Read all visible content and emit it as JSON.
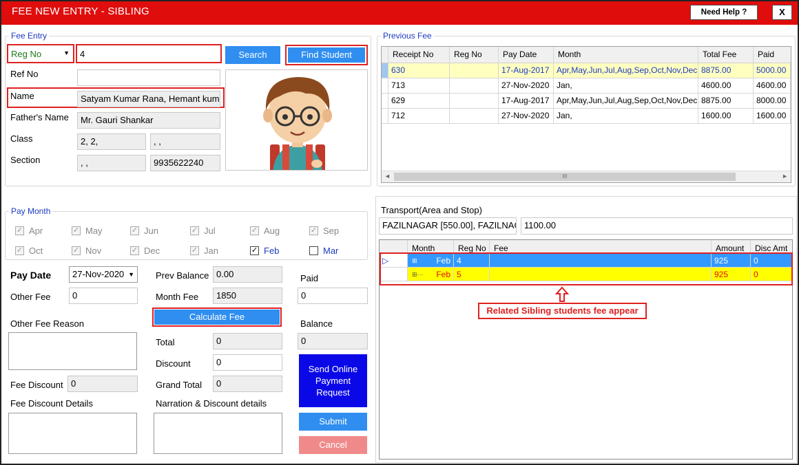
{
  "window": {
    "title": "FEE NEW ENTRY - SIBLING",
    "help_label": "Need Help ?",
    "close_label": "X"
  },
  "fee_entry": {
    "legend": "Fee Entry",
    "search_by": "Reg No",
    "search_value": "4",
    "search_label": "Search",
    "find_student_label": "Find Student",
    "ref_no_label": "Ref No",
    "ref_no_value": "",
    "name_label": "Name",
    "name_value": "Satyam Kumar Rana,  Hemant kum",
    "father_label": "Father's Name",
    "father_value": "Mr. Gauri Shankar",
    "class_label": "Class",
    "class_value_1": "2, 2,",
    "class_value_2": ", ,",
    "section_label": "Section",
    "section_value": ", ,",
    "phone_value": "9935622240"
  },
  "previous_fee": {
    "legend": "Previous Fee",
    "columns": [
      "Receipt No",
      "Reg No",
      "Pay Date",
      "Month",
      "Total Fee",
      "Paid"
    ],
    "rows": [
      {
        "receipt": "630",
        "reg": "",
        "date": "17-Aug-2017",
        "month": "Apr,May,Jun,Jul,Aug,Sep,Oct,Nov,Dec,",
        "total": "8875.00",
        "paid": "5000.00"
      },
      {
        "receipt": "713",
        "reg": "",
        "date": "27-Nov-2020",
        "month": "Jan,",
        "total": "4600.00",
        "paid": "4600.00"
      },
      {
        "receipt": "629",
        "reg": "",
        "date": "17-Aug-2017",
        "month": "Apr,May,Jun,Jul,Aug,Sep,Oct,Nov,Dec,",
        "total": "8875.00",
        "paid": "8000.00"
      },
      {
        "receipt": "712",
        "reg": "",
        "date": "27-Nov-2020",
        "month": "Jan,",
        "total": "1600.00",
        "paid": "1600.00"
      }
    ],
    "scroll_glyph": "III"
  },
  "pay_month": {
    "legend": "Pay Month",
    "months": [
      {
        "label": "Apr",
        "checked": true,
        "enabled": false
      },
      {
        "label": "May",
        "checked": true,
        "enabled": false
      },
      {
        "label": "Jun",
        "checked": true,
        "enabled": false
      },
      {
        "label": "Jul",
        "checked": true,
        "enabled": false
      },
      {
        "label": "Aug",
        "checked": true,
        "enabled": false
      },
      {
        "label": "Sep",
        "checked": true,
        "enabled": false
      },
      {
        "label": "Oct",
        "checked": true,
        "enabled": false
      },
      {
        "label": "Nov",
        "checked": true,
        "enabled": false
      },
      {
        "label": "Dec",
        "checked": true,
        "enabled": false
      },
      {
        "label": "Jan",
        "checked": true,
        "enabled": false
      },
      {
        "label": "Feb",
        "checked": true,
        "enabled": true
      },
      {
        "label": "Mar",
        "checked": false,
        "enabled": true
      }
    ]
  },
  "payment": {
    "pay_date_label": "Pay Date",
    "pay_date_value": "27-Nov-2020",
    "other_fee_label": "Other Fee",
    "other_fee_value": "0",
    "other_fee_reason_label": "Other Fee Reason",
    "fee_discount_label": "Fee Discount",
    "fee_discount_value": "0",
    "fee_discount_details_label": "Fee Discount Details",
    "prev_balance_label": "Prev Balance",
    "prev_balance_value": "0.00",
    "month_fee_label": "Month Fee",
    "month_fee_value": "1850",
    "calculate_label": "Calculate Fee",
    "total_label": "Total",
    "total_value": "0",
    "discount_label": "Discount",
    "discount_value": "0",
    "grand_total_label": "Grand Total",
    "grand_total_value": "0",
    "narration_label": "Narration & Discount  details",
    "paid_label": "Paid",
    "paid_value": "0",
    "balance_label": "Balance",
    "balance_value": "0",
    "send_online_label": "Send Online Payment Request",
    "submit_label": "Submit",
    "cancel_label": "Cancel"
  },
  "transport": {
    "label": "Transport(Area and Stop)",
    "area_value": "FAZILNAGAR [550.00], FAZILNAGA",
    "amount_value": "1100.00"
  },
  "sibling_grid": {
    "columns": [
      "Month",
      "Reg No",
      "Fee",
      "Amount",
      "Disc Amt"
    ],
    "rows": [
      {
        "month": "Feb",
        "reg": "4",
        "fee": "",
        "amount": "925",
        "disc": "0"
      },
      {
        "month": "Feb",
        "reg": "5",
        "fee": "",
        "amount": "925",
        "disc": "0"
      }
    ],
    "callout": "Related Sibling students fee appear"
  },
  "colors": {
    "title_red": "#e00d0d",
    "accent_blue": "#2f8ef0",
    "legend_blue": "#1c3bc1",
    "highlight_yellow": "#ffff00",
    "selected_blue": "#3399ff",
    "navy_button": "#0b08e8",
    "cancel_pink": "#f08a8a"
  }
}
